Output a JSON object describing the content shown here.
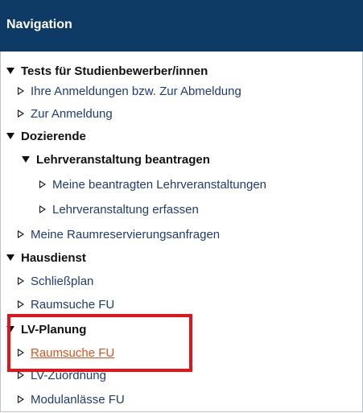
{
  "header": {
    "title": "Navigation"
  },
  "nav": {
    "tests": {
      "label": "Tests für Studienbewerber/innen",
      "items": [
        "Ihre Anmeldungen bzw. Zur Abmeldung",
        "Zur Anmeldung"
      ]
    },
    "dozierende": {
      "label": "Dozierende",
      "lehrveranstaltung": {
        "label": "Lehrveranstaltung beantragen",
        "items": [
          "Meine beantragten Lehrveranstaltungen",
          "Lehrveranstaltung erfassen"
        ]
      },
      "items": [
        "Meine Raumreservierungsanfragen"
      ]
    },
    "hausdienst": {
      "label": "Hausdienst",
      "items": [
        "Schließplan",
        "Raumsuche FU"
      ]
    },
    "lvplanung": {
      "label": "LV-Planung",
      "items": [
        "Raumsuche FU",
        "LV-Zuordnung",
        "Modulanlässe FU"
      ]
    }
  },
  "colors": {
    "header_bg": "#0d3b66",
    "active_link": "#e0521b",
    "highlight": "#e3151b"
  }
}
